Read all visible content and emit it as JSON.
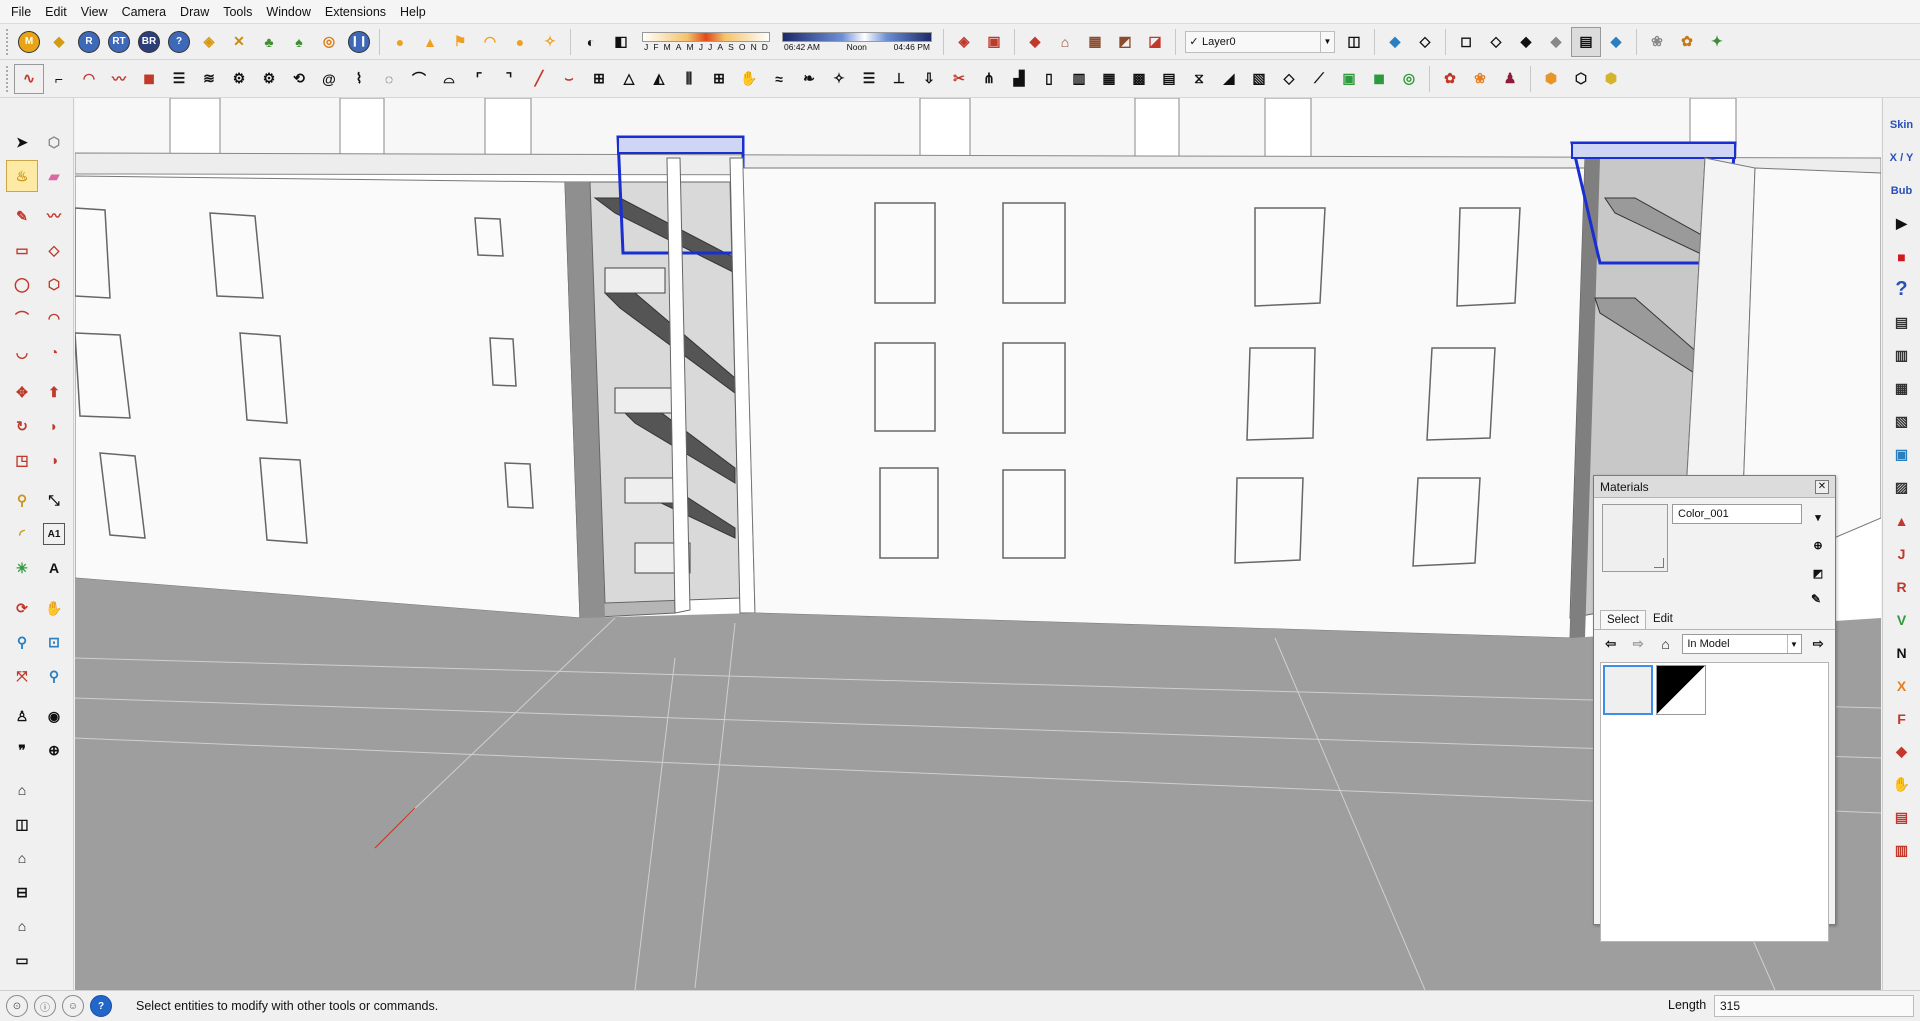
{
  "menu": [
    "File",
    "Edit",
    "View",
    "Camera",
    "Draw",
    "Tools",
    "Window",
    "Extensions",
    "Help"
  ],
  "toolbar": {
    "months": [
      "J",
      "F",
      "M",
      "A",
      "M",
      "J",
      "J",
      "A",
      "S",
      "O",
      "N",
      "D"
    ],
    "time_labels": [
      "06:42 AM",
      "Noon",
      "04:46 PM"
    ],
    "layer": "Layer0",
    "badges": [
      "M",
      "R",
      "RT",
      "BR"
    ]
  },
  "right_toolbar": {
    "labels": [
      "Skin",
      "X / Y",
      "Bub"
    ],
    "letters": [
      "J",
      "R",
      "V",
      "N",
      "X",
      "F"
    ]
  },
  "materials": {
    "title": "Materials",
    "name": "Color_001",
    "tabs": [
      "Select",
      "Edit"
    ],
    "collection": "In Model",
    "colors": {
      "primary": "#efefef",
      "secondary": "#000000",
      "accent": "#3d8ee8"
    }
  },
  "status": {
    "message": "Select entities to modify with other tools or commands.",
    "measure_label": "Length",
    "measure_value": "315"
  }
}
